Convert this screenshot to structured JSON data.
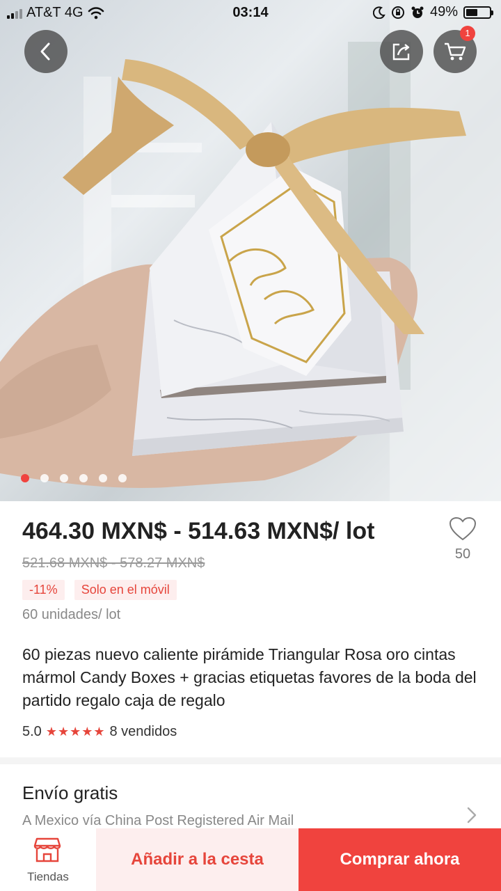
{
  "status_bar": {
    "carrier": "AT&T 4G",
    "time": "03:14",
    "battery": "49%",
    "battery_level": 0.49,
    "icons": [
      "signal-icon",
      "wifi-icon",
      "moon-icon",
      "rotation-lock-icon",
      "alarm-icon",
      "battery-icon"
    ]
  },
  "nav": {
    "icons": [
      "back-arrow-icon",
      "share-icon",
      "cart-icon"
    ],
    "cart_badge": "1"
  },
  "gallery": {
    "image_count": 6,
    "active_index": 0
  },
  "product": {
    "price": "464.30 MXN$ - 514.63 MXN$/ lot",
    "original_price": "521.68 MXN$ - 578.27 MXN$",
    "discount_tag": "-11%",
    "mobile_tag": "Solo en el móvil",
    "units": "60 unidades/ lot",
    "title": "60 piezas nuevo caliente pirámide Triangular Rosa oro cintas mármol Candy Boxes + gracias etiquetas favores de la boda del partido regalo caja de regalo",
    "rating": "5.0",
    "stars": "★★★★★",
    "sold": "8 vendidos",
    "favorites": "50"
  },
  "shipping": {
    "title": "Envío gratis",
    "subtitle": "A Mexico vía China Post Registered Air Mail"
  },
  "bottom_bar": {
    "store_label": "Tiendas",
    "add_to_cart": "Añadir a la cesta",
    "buy_now": "Comprar ahora"
  },
  "colors": {
    "accent": "#f0433e",
    "accent_light": "#fdeeee",
    "ribbon": "#d9b77e"
  }
}
